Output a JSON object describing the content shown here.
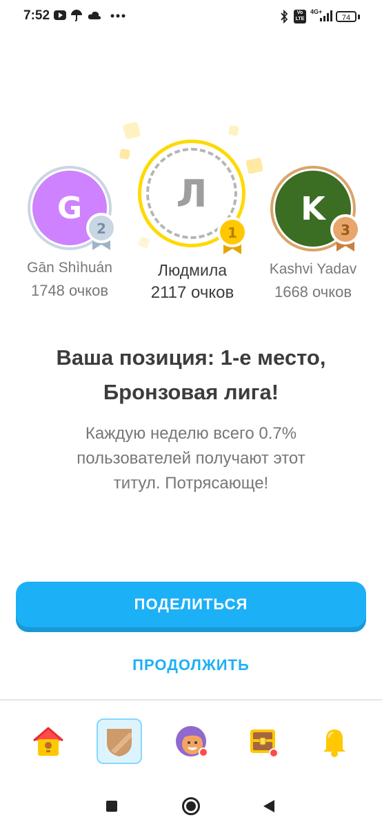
{
  "status_bar": {
    "time": "7:52",
    "icons": [
      "youtube-icon",
      "umbrella-icon",
      "cloud-icon",
      "more-dots-icon",
      "bluetooth-icon",
      "volte-icon",
      "signal-4g-icon",
      "signal-bars-icon"
    ],
    "network": "4G+",
    "volte_label": "Vo LTE",
    "battery": "74"
  },
  "podium": [
    {
      "rank": "2",
      "initial": "G",
      "name": "Gān Shìhuán",
      "points": "1748 очков",
      "avatar_color": "#ce82ff",
      "ring_color": "#c9d6e3",
      "medal_color": "#c9d6e3",
      "medal_text_color": "#7b8fa3"
    },
    {
      "rank": "1",
      "initial": "Л",
      "name": "Людмила",
      "points": "2117 очков",
      "avatar_color": "#ffffff",
      "ring_color": "#ffd900",
      "medal_color": "#ffc800",
      "medal_text_color": "#b37f00"
    },
    {
      "rank": "3",
      "initial": "K",
      "name": "Kashvi Yadav",
      "points": "1668 очков",
      "avatar_color": "#3b6d22",
      "ring_color": "#d9a36a",
      "medal_color": "#e8a66b",
      "medal_text_color": "#9a5a1c"
    }
  ],
  "message": {
    "title_line1": "Ваша позиция: 1-е место,",
    "title_line2": "Бронзовая лига!",
    "subtitle_line1": "Каждую неделю всего 0.7%",
    "subtitle_line2": "пользователей получают этот",
    "subtitle_line3": "титул. Потрясающе!"
  },
  "buttons": {
    "share": "ПОДЕЛИТЬСЯ",
    "continue": "ПРОДОЛЖИТЬ"
  },
  "bottom_nav": [
    {
      "name": "home",
      "icon": "house-icon",
      "selected": false
    },
    {
      "name": "leagues",
      "icon": "shield-icon",
      "selected": true
    },
    {
      "name": "profile",
      "icon": "character-icon",
      "selected": false,
      "badge": true
    },
    {
      "name": "shop",
      "icon": "chest-icon",
      "selected": false,
      "badge": true
    },
    {
      "name": "notifications",
      "icon": "bell-icon",
      "selected": false
    }
  ],
  "system_nav": [
    "recents-square-icon",
    "home-circle-icon",
    "back-triangle-icon"
  ],
  "colors": {
    "accent": "#1cb0f6",
    "accent_shadow": "#1899d6",
    "gold": "#ffc800",
    "silver": "#c9d6e3",
    "bronze": "#e8a66b"
  }
}
